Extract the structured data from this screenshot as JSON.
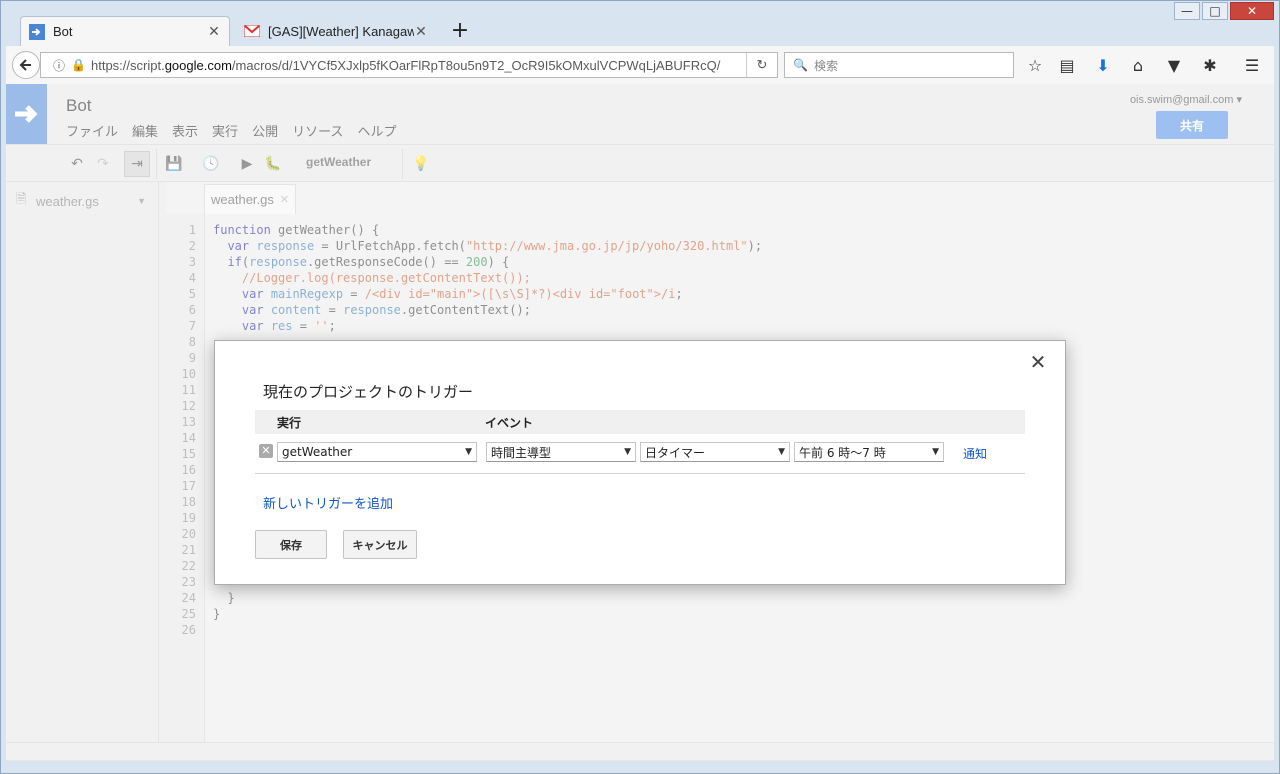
{
  "browser": {
    "tabs": [
      {
        "label": "Bot",
        "active": true
      },
      {
        "label": "[GAS][Weather] Kanagaw",
        "active": false
      }
    ],
    "url_prefix": "https://script.",
    "url_domain": "google.com",
    "url_rest": "/macros/d/1VYCf5XJxlp5fKOarFlRpT8ou5n9T2_OcR9I5kOMxulVCPWqLjABUFRcQ/",
    "search_placeholder": "検索"
  },
  "app": {
    "project_title": "Bot",
    "menu": [
      "ファイル",
      "編集",
      "表示",
      "実行",
      "公開",
      "リソース",
      "ヘルプ"
    ],
    "account_email": "ois.swim@gmail.com",
    "share_label": "共有",
    "function_select": "getWeather",
    "file_name": "weather.gs",
    "editor_tab": "weather.gs"
  },
  "code_lines": [
    "1",
    "2",
    "3",
    "4",
    "5",
    "6",
    "7",
    "8",
    "9",
    "10",
    "11",
    "12",
    "13",
    "14",
    "15",
    "16",
    "17",
    "18",
    "19",
    "20",
    "21",
    "22",
    "23",
    "24",
    "25",
    "26"
  ],
  "dialog": {
    "title": "現在のプロジェクトのトリガー",
    "col_exec": "実行",
    "col_event": "イベント",
    "function_value": "getWeather",
    "event_source": "時間主導型",
    "timer_type": "日タイマー",
    "time_range": "午前 6 時〜7 時",
    "notify_label": "通知",
    "add_trigger_label": "新しいトリガーを追加",
    "save_label": "保存",
    "cancel_label": "キャンセル"
  }
}
